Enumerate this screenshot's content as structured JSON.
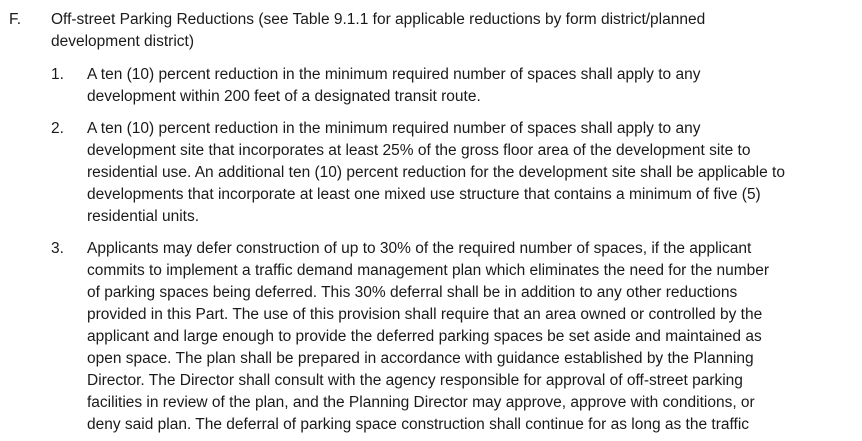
{
  "section": {
    "letter": "F.",
    "heading_lines": [
      "Off-street Parking Reductions (see Table 9.1.1 for applicable reductions by form district/planned",
      "development district)"
    ]
  },
  "items": [
    {
      "number": "1.",
      "lines": [
        "A ten (10) percent reduction in the minimum required number of spaces shall apply to any",
        "development within 200 feet of a designated transit route."
      ]
    },
    {
      "number": "2.",
      "lines": [
        "A ten (10) percent reduction in the minimum required number of spaces shall apply to any",
        "development site that incorporates at least 25% of the gross floor area of the development site to",
        "residential use. An additional ten (10) percent reduction for the development site shall be applicable to",
        "developments that incorporate at least one mixed use structure that contains a minimum of five (5)",
        "residential units."
      ]
    },
    {
      "number": "3.",
      "lines": [
        "Applicants may defer construction of up to 30% of the required number of spaces, if the applicant",
        "commits to implement a traffic demand management plan which eliminates the need for the number",
        "of parking spaces being deferred. This 30% deferral shall be in addition to any other reductions",
        "provided in this Part. The use of this provision shall require that an area owned or controlled by the",
        "applicant and large enough to provide the deferred parking spaces be set aside and maintained as",
        "open space. The plan shall be prepared in accordance with guidance established by the Planning",
        "Director. The Director shall consult with the agency responsible for approval of off-street parking",
        "facilities in review of the plan, and the Planning Director may approve, approve with conditions, or",
        "deny said plan. The deferral of parking space construction shall continue for as long as the traffic"
      ]
    }
  ]
}
